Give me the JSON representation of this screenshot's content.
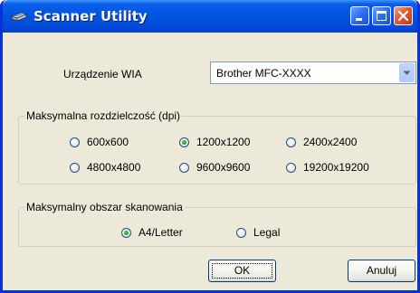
{
  "window": {
    "title": "Scanner Utility",
    "icon": "scanner-icon",
    "controls": [
      "minimize-icon",
      "maximize-icon",
      "close-icon"
    ]
  },
  "device": {
    "label": "Urządzenie WIA",
    "selected": "Brother MFC-XXXX"
  },
  "resolution": {
    "legend": "Maksymalna rozdzielczość (dpi)",
    "options": [
      {
        "label": "600x600",
        "checked": false
      },
      {
        "label": "1200x1200",
        "checked": true
      },
      {
        "label": "2400x2400",
        "checked": false
      },
      {
        "label": "4800x4800",
        "checked": false
      },
      {
        "label": "9600x9600",
        "checked": false
      },
      {
        "label": "19200x19200",
        "checked": false
      }
    ]
  },
  "scan_area": {
    "legend": "Maksymalny obszar skanowania",
    "options": [
      {
        "label": "A4/Letter",
        "checked": true
      },
      {
        "label": "Legal",
        "checked": false
      }
    ]
  },
  "buttons": {
    "ok": "OK",
    "cancel": "Anuluj"
  },
  "colors": {
    "titlebar": "#0054e3",
    "window_bg": "#ece9d8",
    "radio_check": "#21a121"
  }
}
